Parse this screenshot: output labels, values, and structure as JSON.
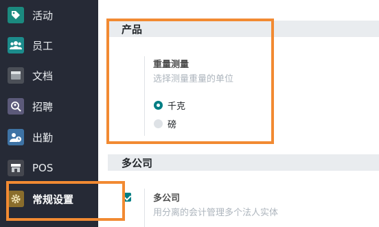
{
  "sidebar": {
    "items": [
      {
        "label": "活动",
        "icon": "tag-icon",
        "icon_color": "#1b8a7f"
      },
      {
        "label": "员工",
        "icon": "people-icon",
        "icon_color": "#1c8c8c"
      },
      {
        "label": "文档",
        "icon": "document-icon",
        "icon_color": "#4b4f57"
      },
      {
        "label": "招聘",
        "icon": "search-person-icon",
        "icon_color": "#5c5a7a"
      },
      {
        "label": "出勤",
        "icon": "clock-person-icon",
        "icon_color": "#3e73a5"
      },
      {
        "label": "POS",
        "icon": "store-icon",
        "icon_color": "#45474f"
      },
      {
        "label": "常规设置",
        "icon": "gear-icon",
        "icon_color": "#8a6d2c"
      }
    ],
    "active_index": 6
  },
  "sections": {
    "product": {
      "title": "产品",
      "setting_title": "重量测量",
      "setting_desc": "选择测量重量的单位",
      "options": [
        {
          "label": "千克",
          "selected": true
        },
        {
          "label": "磅",
          "selected": false
        }
      ]
    },
    "multi_company": {
      "title": "多公司",
      "setting_title": "多公司",
      "setting_desc": "用分离的会计管理多个法人实体",
      "checked": true
    }
  },
  "colors": {
    "sidebar_bg": "#262a36",
    "accent": "#017e84",
    "highlight": "#f28a32",
    "section_band": "#e9ecef"
  }
}
